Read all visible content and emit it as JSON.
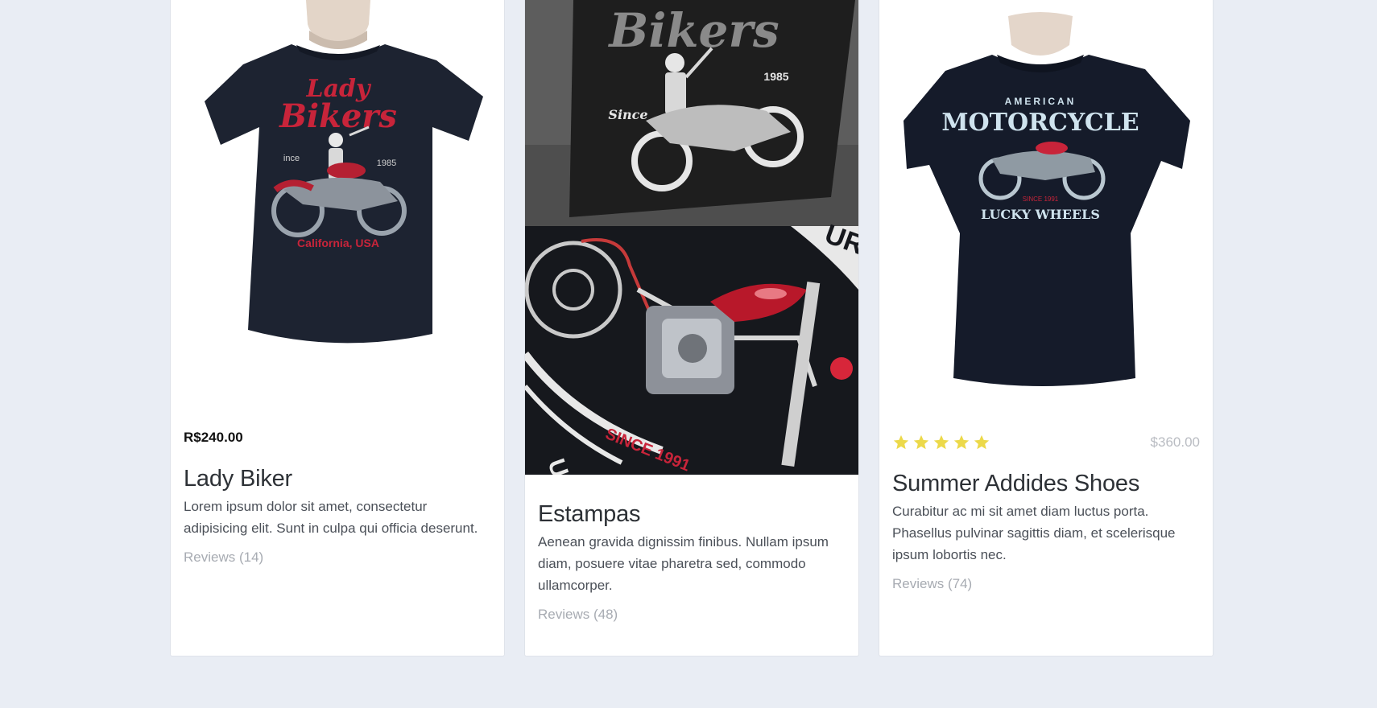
{
  "cards": [
    {
      "price": "R$240.00",
      "title": "Lady Biker",
      "description": "Lorem ipsum dolor sit amet, consectetur adipisicing elit. Sunt in culpa qui officia deserunt.",
      "reviews": "Reviews (14)",
      "image": {
        "subject": "black t-shirt on mannequin",
        "print_lines": [
          "Lady",
          "Bikers",
          "ince",
          "1985",
          "California, USA"
        ]
      }
    },
    {
      "title": "Estampas",
      "description": "Aenean gravida dignissim finibus. Nullam ipsum diam, posuere vitae pharetra sed, commodo ullamcorper.",
      "reviews": "Reviews (48)",
      "image_top": {
        "subject": "folded black t-shirt, grayscale",
        "print_lines": [
          "Bikers",
          "Since",
          "1985"
        ]
      },
      "image_bottom": {
        "subject": "close-up of motorcycle print",
        "print_lines": [
          "SINCE 1991",
          "URTY",
          "UCKY"
        ]
      }
    },
    {
      "rating": 5,
      "price": "$360.00",
      "title": "Summer Addides Shoes",
      "description": "Curabitur ac mi sit amet diam luctus porta. Phasellus pulvinar sagittis diam, et scelerisque ipsum lobortis nec.",
      "reviews": "Reviews (74)",
      "image": {
        "subject": "black t-shirt on mannequin",
        "print_lines": [
          "AMERICAN",
          "MOTORCYCLE",
          "SINCE 1991",
          "LUCKY WHEELS"
        ]
      }
    }
  ],
  "colors": {
    "page_bg": "#e9edf4",
    "star": "#ecd94a",
    "accent_red": "#c8243a"
  }
}
